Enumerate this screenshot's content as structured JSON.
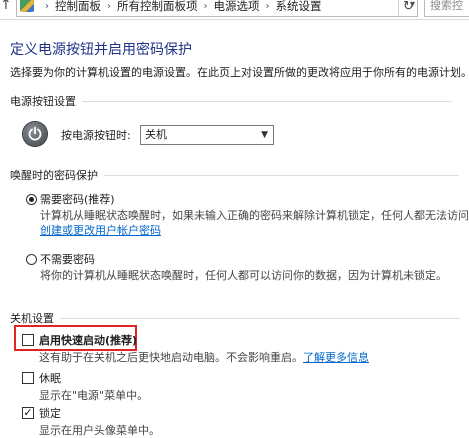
{
  "address_bar": {
    "breadcrumbs": [
      "控制面板",
      "所有控制面板项",
      "电源选项",
      "系统设置"
    ],
    "search_placeholder": "搜索控"
  },
  "page": {
    "title": "定义电源按钮并启用密码保护",
    "subtitle": "选择要为你的计算机设置的电源设置。在此页上对设置所做的更改将应用于你所有的电源计划。"
  },
  "power_button_section": {
    "heading": "电源按钮设置",
    "label": "按电源按钮时:",
    "selected": "关机"
  },
  "password_section": {
    "heading": "唤醒时的密码保护",
    "options": [
      {
        "label": "需要密码(推荐)",
        "selected": true,
        "desc": "计算机从睡眠状态唤醒时，如果未输入正确的密码来解除计算机锁定，任何人都无法访问你",
        "link": "创建或更改用户帐户密码"
      },
      {
        "label": "不需要密码",
        "selected": false,
        "desc": "将你的计算机从睡眠状态唤醒时，任何人都可以访问你的数据，因为计算机未锁定。"
      }
    ]
  },
  "shutdown_section": {
    "heading": "关机设置",
    "items": [
      {
        "label": "启用快速启动(推荐)",
        "checked": false,
        "desc": "这有助于在关机之后更快地启动电脑。不会影响重启。",
        "link": "了解更多信息"
      },
      {
        "label": "休眠",
        "checked": false,
        "desc": "显示在\"电源\"菜单中。"
      },
      {
        "label": "锁定",
        "checked": true,
        "desc": "显示在用户头像菜单中。"
      }
    ]
  },
  "colors": {
    "title": "#1e3287",
    "link": "#0066cc",
    "highlight": "#e02424"
  }
}
